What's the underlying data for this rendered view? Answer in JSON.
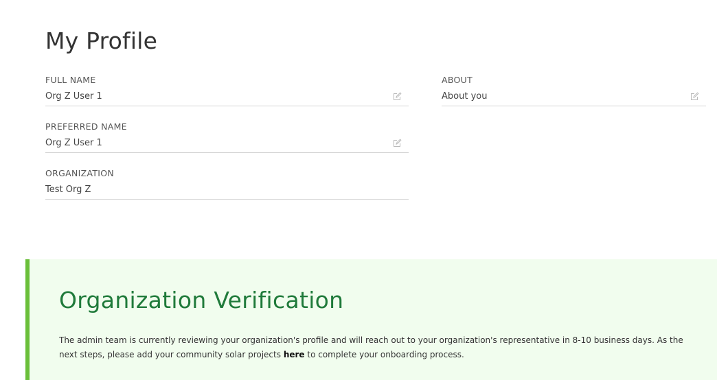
{
  "profile": {
    "title": "My Profile",
    "full_name": {
      "label": "FULL NAME",
      "value": "Org Z User 1"
    },
    "preferred_name": {
      "label": "PREFERRED NAME",
      "value": "Org Z User 1"
    },
    "organization": {
      "label": "ORGANIZATION",
      "value": "Test Org Z"
    },
    "about": {
      "label": "ABOUT",
      "value": "About you"
    }
  },
  "verification": {
    "title": "Organization Verification",
    "text_before": "The admin team is currently reviewing your organization's profile and will reach out to your organization's representative in 8-10 business days. As the next steps, please add your community solar projects ",
    "link_text": "here",
    "text_after": " to complete your onboarding process."
  },
  "icons": {
    "edit": "edit-icon"
  },
  "colors": {
    "accent_green": "#6abf3a",
    "heading_green": "#1f7a3a",
    "panel_background": "#f1fdee"
  }
}
